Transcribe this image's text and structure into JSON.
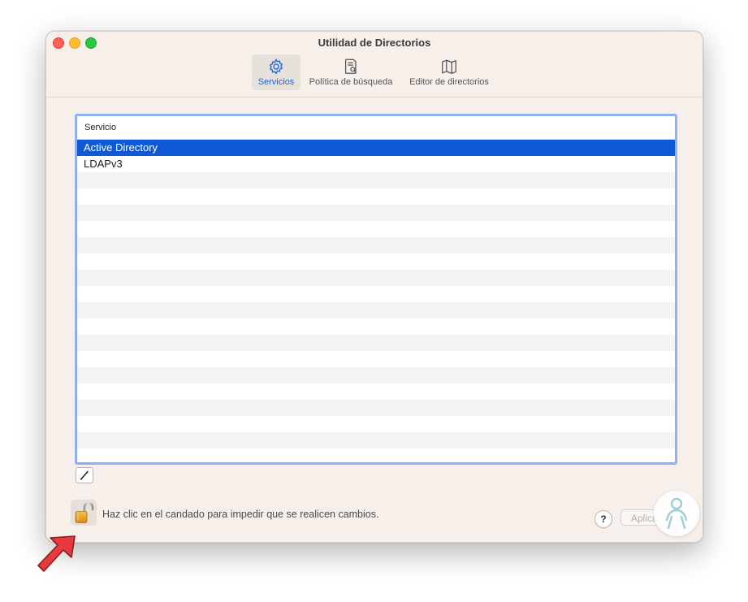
{
  "window": {
    "title": "Utilidad de Directorios"
  },
  "toolbar": {
    "items": [
      {
        "label": "Servicios",
        "icon": "gear-icon",
        "active": true
      },
      {
        "label": "Política de búsqueda",
        "icon": "search-policy-icon",
        "active": false
      },
      {
        "label": "Editor de directorios",
        "icon": "map-icon",
        "active": false
      }
    ]
  },
  "services_table": {
    "header": "Servicio",
    "rows": [
      {
        "name": "Active Directory",
        "selected": true
      },
      {
        "name": "LDAPv3",
        "selected": false
      }
    ]
  },
  "footer": {
    "lock_message": "Haz clic en el candado para impedir que se realicen cambios.",
    "help_label": "?",
    "apply_label": "Aplicar"
  },
  "colors": {
    "accent": "#1059d6",
    "focus_ring": "#8eaef5",
    "window_bg": "#f6efea",
    "arrow": "#e8393e"
  }
}
